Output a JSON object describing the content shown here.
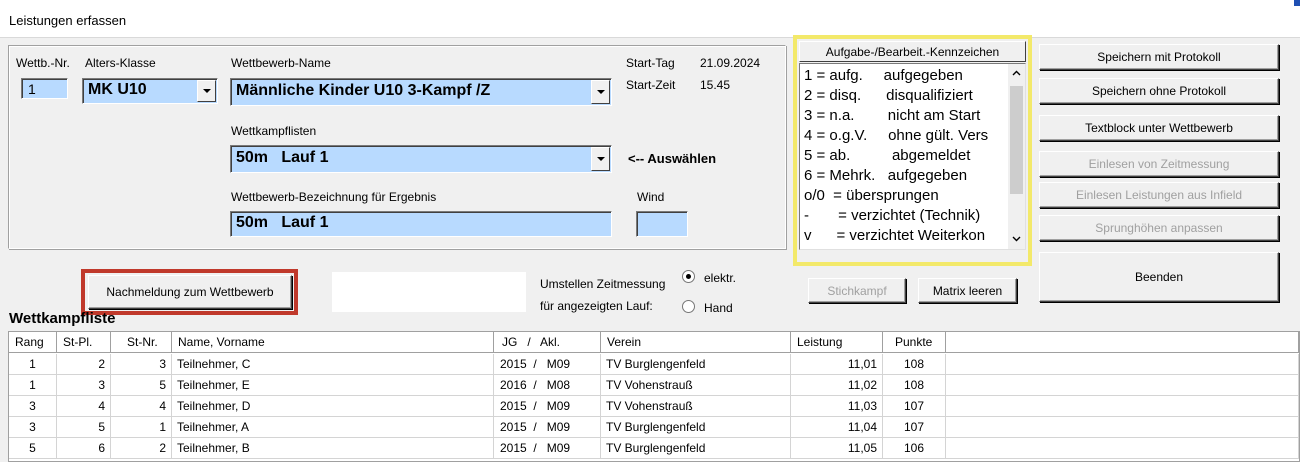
{
  "window": {
    "title": "Leistungen erfassen"
  },
  "form": {
    "wettb_nr_label": "Wettb.-Nr.",
    "wettb_nr_value": "1",
    "alters_klasse_label": "Alters-Klasse",
    "alters_klasse_value": "MK U10",
    "wettbewerb_name_label": "Wettbewerb-Name",
    "wettbewerb_name_value": "Männliche Kinder U10  3-Kampf /Z",
    "start_tag_label": "Start-Tag",
    "start_tag_value": "21.09.2024",
    "start_zeit_label": "Start-Zeit",
    "start_zeit_value": "15.45",
    "wettkampflisten_label": "Wettkampflisten",
    "wettkampflisten_value": "50m   Lauf 1",
    "auswaehlen_hint": "<-- Auswählen",
    "bezeichnung_label": "Wettbewerb-Bezeichnung für Ergebnis",
    "bezeichnung_value": "50m   Lauf 1",
    "wind_label": "Wind",
    "wind_value": ""
  },
  "kennzeichen": {
    "header": "Aufgabe-/Bearbeit.-Kennzeichen",
    "items": [
      "1 = aufg.     aufgegeben",
      "2 = disq.      disqualifiziert",
      "3 = n.a.        nicht am Start",
      "4 = o.g.V.     ohne gült. Vers",
      "5 = ab.          abgemeldet",
      "6 = Mehrk.   aufgegeben",
      "o/0  = übersprungen",
      "-       = verzichtet (Technik)",
      "v      = verzichtet Weiterkon"
    ]
  },
  "buttons": {
    "speichern_mit": "Speichern mit Protokoll",
    "speichern_ohne": "Speichern ohne Protokoll",
    "textblock": "Textblock unter Wettbewerb",
    "einlesen_zeit": "Einlesen von Zeitmessung",
    "einlesen_infield": "Einlesen Leistungen aus Infield",
    "sprunghoehen": "Sprunghöhen anpassen",
    "beenden": "Beenden",
    "nachmeldung": "Nachmeldung zum Wettbewerb",
    "stichkampf": "Stichkampf",
    "matrix_leeren": "Matrix leeren"
  },
  "zeitmessung": {
    "label_line1": "Umstellen Zeitmessung",
    "label_line2": "für angezeigten Lauf:",
    "option_elektr": "elektr.",
    "option_hand": "Hand",
    "selected": "elektr."
  },
  "list_title": "Wettkampfliste",
  "table": {
    "columns": [
      "Rang",
      "St-Pl.",
      "St-Nr.",
      "Name, Vorname",
      "JG   /   Akl.",
      "Verein",
      "Leistung",
      "Punkte"
    ],
    "rows": [
      {
        "rang": "1",
        "stpl": "2",
        "stnr": "3",
        "name": "Teilnehmer, C",
        "jg": "2015  /   M09",
        "verein": "TV Burglengenfeld",
        "leistung": "11,01",
        "punkte": "108"
      },
      {
        "rang": "1",
        "stpl": "3",
        "stnr": "5",
        "name": "Teilnehmer, E",
        "jg": "2016  /   M08",
        "verein": "TV Vohenstrauß",
        "leistung": "11,02",
        "punkte": "108"
      },
      {
        "rang": "3",
        "stpl": "4",
        "stnr": "4",
        "name": "Teilnehmer, D",
        "jg": "2015  /   M09",
        "verein": "TV Vohenstrauß",
        "leistung": "11,03",
        "punkte": "107"
      },
      {
        "rang": "3",
        "stpl": "5",
        "stnr": "1",
        "name": "Teilnehmer, A",
        "jg": "2015  /   M09",
        "verein": "TV Burglengenfeld",
        "leistung": "11,04",
        "punkte": "107"
      },
      {
        "rang": "5",
        "stpl": "6",
        "stnr": "2",
        "name": "Teilnehmer, B",
        "jg": "2015  /   M09",
        "verein": "TV Burglengenfeld",
        "leistung": "11,05",
        "punkte": "106"
      }
    ]
  },
  "colors": {
    "field_bg": "#b8daff",
    "highlight_yellow": "#f3e96a",
    "highlight_red": "#c0392b"
  }
}
